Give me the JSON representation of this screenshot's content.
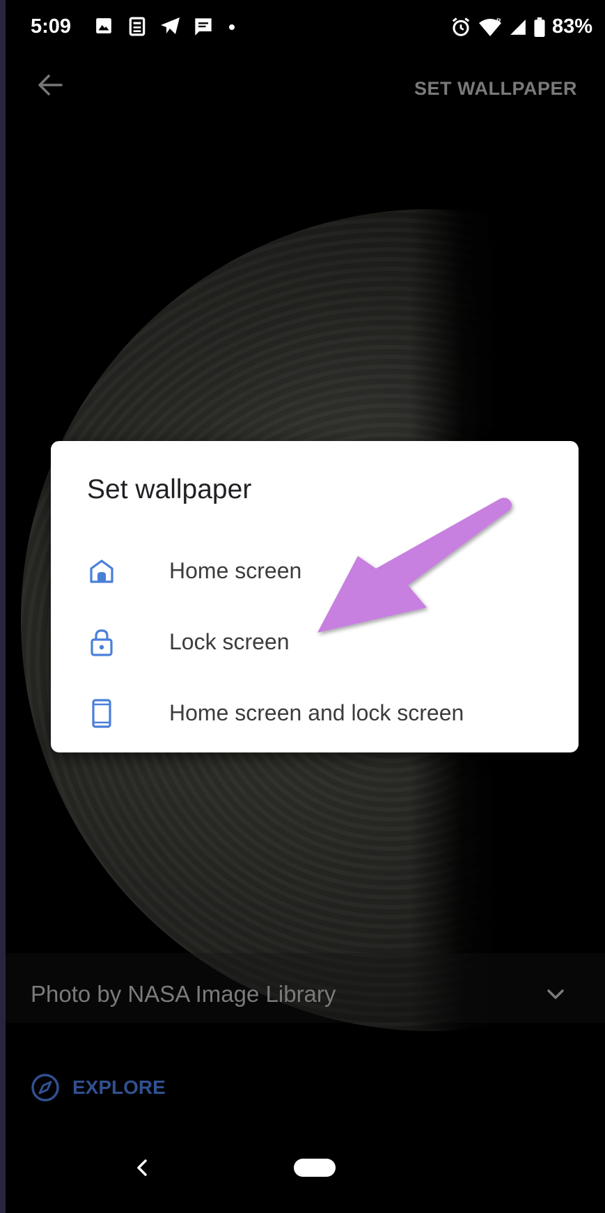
{
  "status_bar": {
    "time": "5:09",
    "battery": "83%",
    "left_icons": [
      "image-icon",
      "news-icon",
      "telegram-icon",
      "message-icon",
      "dot-icon"
    ],
    "right_icons": [
      "alarm-icon",
      "wifi-icon",
      "signal-icon",
      "battery-icon"
    ]
  },
  "app_bar": {
    "back_icon": "back-arrow-icon",
    "action_label": "SET WALLPAPER"
  },
  "dialog": {
    "title": "Set wallpaper",
    "options": [
      {
        "label": "Home screen",
        "icon": "home-icon"
      },
      {
        "label": "Lock screen",
        "icon": "lock-icon"
      },
      {
        "label": "Home screen and lock screen",
        "icon": "phone-icon"
      }
    ],
    "accent_color": "#4a7fd8"
  },
  "footer": {
    "attribution": "Photo by NASA Image Library",
    "explore_label": "EXPLORE",
    "explore_icon": "compass-icon"
  },
  "nav_bar": {
    "back_icon": "nav-back-icon",
    "home_icon": "nav-home-pill"
  },
  "annotation": {
    "arrow_color": "#c77fe0",
    "points_to": "Lock screen"
  }
}
